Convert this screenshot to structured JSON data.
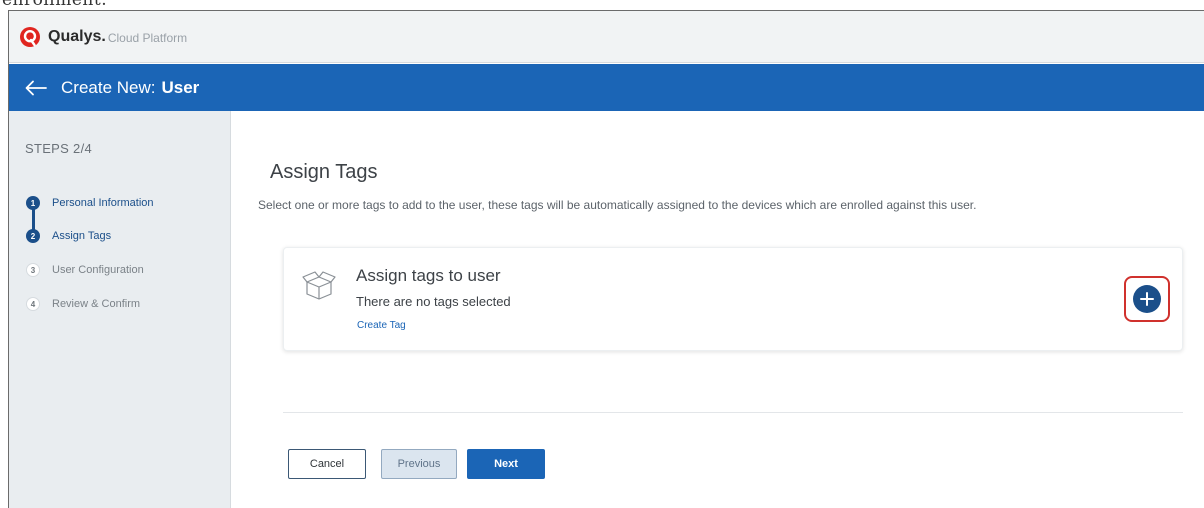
{
  "header_partial_text": "enrollment.",
  "brand": {
    "name": "Qualys.",
    "product": "Cloud Platform",
    "logo_color": "#e0251f"
  },
  "titlebar": {
    "prefix": "Create New:",
    "entity": "User",
    "color": "#1b65b6"
  },
  "sidebar": {
    "steps_label": "STEPS 2/4",
    "steps": [
      {
        "num": "1",
        "label": "Personal Information",
        "state": "completed"
      },
      {
        "num": "2",
        "label": "Assign Tags",
        "state": "current"
      },
      {
        "num": "3",
        "label": "User Configuration",
        "state": "upcoming"
      },
      {
        "num": "4",
        "label": "Review & Confirm",
        "state": "upcoming"
      }
    ]
  },
  "main": {
    "title": "Assign Tags",
    "description": "Select one or more tags to add to the user, these tags will be automatically assigned to the devices which are enrolled against this user.",
    "card": {
      "title": "Assign tags to user",
      "subtitle": "There are no tags selected",
      "link": "Create Tag",
      "add_icon": "plus-icon"
    }
  },
  "footer": {
    "cancel": "Cancel",
    "previous": "Previous",
    "next": "Next"
  }
}
